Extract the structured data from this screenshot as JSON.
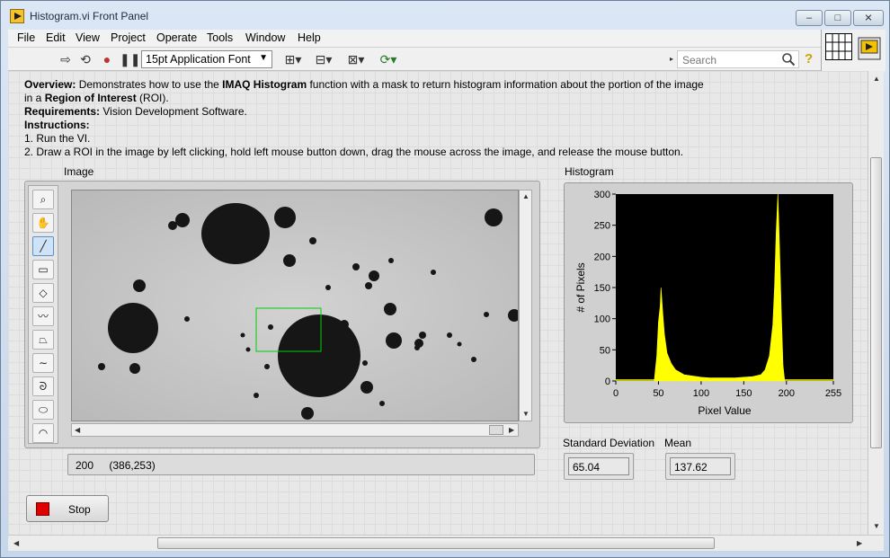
{
  "window": {
    "title": "Histogram.vi Front Panel",
    "min_glyph": "–",
    "max_glyph": "□",
    "close_glyph": "✕"
  },
  "menu": [
    "File",
    "Edit",
    "View",
    "Project",
    "Operate",
    "Tools",
    "Window",
    "Help"
  ],
  "toolbar": {
    "font": "15pt Application Font",
    "search_placeholder": "Search",
    "help_glyph": "?"
  },
  "description": {
    "overview_label": "Overview:",
    "overview_pre": " Demonstrates how to use the ",
    "overview_bold": "IMAQ Histogram",
    "overview_mid": " function with a mask to return histogram information about the portion of the image in a ",
    "overview_bold2": "Region of Interest",
    "overview_post": " (ROI).",
    "requirements_label": "Requirements:",
    "requirements_text": " Vision Development Software.",
    "instructions_label": "Instructions:",
    "step1": "1. Run the VI.",
    "step2": "2. Draw a ROI in the image by left clicking, hold left mouse button down, drag the mouse across the image, and release the mouse button."
  },
  "image_panel": {
    "label": "Image",
    "status_value": "200",
    "status_coords": "(386,253)"
  },
  "histogram": {
    "label": "Histogram",
    "std_label": "Standard Deviation",
    "std_value": "65.04",
    "mean_label": "Mean",
    "mean_value": "137.62"
  },
  "stop_button": {
    "label": "Stop"
  },
  "chart_data": {
    "type": "area",
    "xlabel": "Pixel Value",
    "ylabel": "# of Pixels",
    "xlim": [
      0,
      255
    ],
    "ylim": [
      0,
      300
    ],
    "xticks": [
      0,
      50,
      100,
      150,
      200,
      255
    ],
    "yticks": [
      0,
      50,
      100,
      150,
      200,
      250,
      300
    ],
    "grid": false,
    "background": "#000000",
    "series": [
      {
        "color": "#ffff00",
        "x": [
          45,
          48,
          50,
          52,
          53,
          55,
          57,
          60,
          65,
          70,
          80,
          90,
          100,
          110,
          120,
          130,
          140,
          150,
          160,
          170,
          175,
          180,
          184,
          186,
          188,
          190,
          192,
          194,
          196,
          198
        ],
        "values": [
          0,
          40,
          95,
          120,
          150,
          110,
          75,
          45,
          28,
          18,
          10,
          8,
          6,
          5,
          5,
          5,
          5,
          6,
          7,
          10,
          18,
          40,
          90,
          150,
          240,
          300,
          210,
          110,
          25,
          0
        ]
      }
    ]
  }
}
